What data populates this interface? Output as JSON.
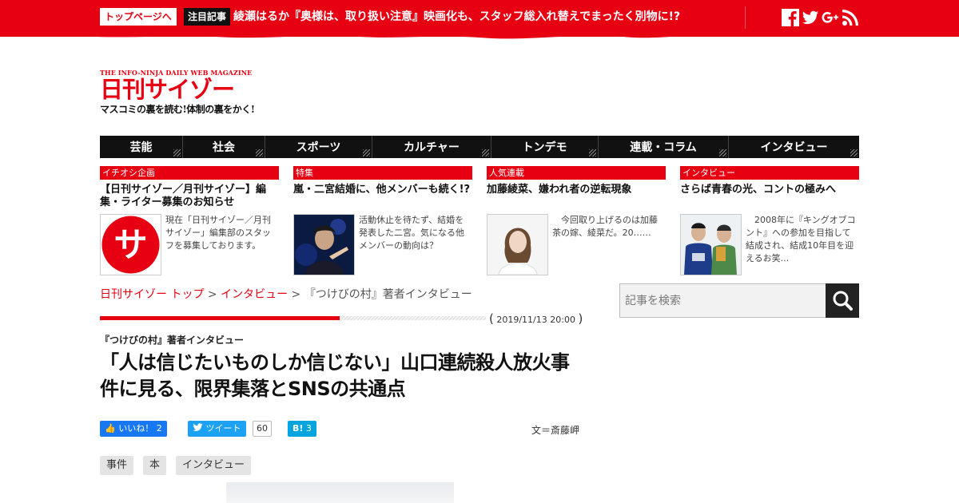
{
  "topbar": {
    "home_label": "トップページへ",
    "pickup_label": "注目記事",
    "pickup_text": "綾瀬はるか『奥様は、取り扱い注意』映画化も、スタッフ総入れ替えでまったく別物に!?",
    "social": [
      "facebook-icon",
      "twitter-icon",
      "google-plus-icon",
      "rss-icon"
    ]
  },
  "logo": {
    "tagline": "THE INFO-NINJA DAILY WEB MAGAZINE",
    "title": "日刊サイゾー",
    "subtitle": "マスコミの裏を読む!体制の裏をかく!"
  },
  "nav": [
    "芸能",
    "社会",
    "スポーツ",
    "カルチャー",
    "トンデモ",
    "連載・コラム",
    "インタビュー"
  ],
  "features": [
    {
      "label": "イチオシ企画",
      "title": "【日刊サイゾー／月刊サイゾー】編集・ライター募集のお知らせ",
      "text": "現在「日刊サイゾー／月刊サイゾー」編集部のスタッフを募集しております。",
      "thumb_mark": "サ"
    },
    {
      "label": "特集",
      "title": "嵐・二宮結婚に、他メンバーも続く!?",
      "text": "活動休止を待たず、結婚を発表した二宮。気になる他メンバーの動向は？"
    },
    {
      "label": "人気連載",
      "title": "加藤綾菜、嫌われ者の逆転現象",
      "text": "　今回取り上げるのは加藤茶の嫁、綾菜だ。20……"
    },
    {
      "label": "インタビュー",
      "title": "さらば青春の光、コントの極みへ",
      "text": "　2008年に『キングオブコント』への参加を目指して結成され、結成10年目を迎えるお笑..."
    }
  ],
  "breadcrumb": {
    "home": "日刊サイゾー トップ",
    "sep": ">",
    "category": "インタビュー",
    "sep2": ">",
    "current": "『つけびの村』著者インタビュー"
  },
  "article": {
    "date": "2019/11/13 20:00",
    "kicker": "『つけびの村』著者インタビュー",
    "headline": "「人は信じたいものしか信じない」山口連続殺人放火事件に見る、限界集落とSNSの共通点",
    "author": "文＝斎藤岬",
    "share": {
      "fb_label": "いいね！",
      "fb_count": "2",
      "tw_label": "ツイート",
      "tw_count": "60",
      "hb_label": "B!",
      "hb_count": "3"
    },
    "tags": [
      "事件",
      "本",
      "インタビュー"
    ]
  },
  "search": {
    "placeholder": "記事を検索"
  },
  "colors": {
    "brand_red": "#e60012",
    "nav_bg": "#111111"
  }
}
